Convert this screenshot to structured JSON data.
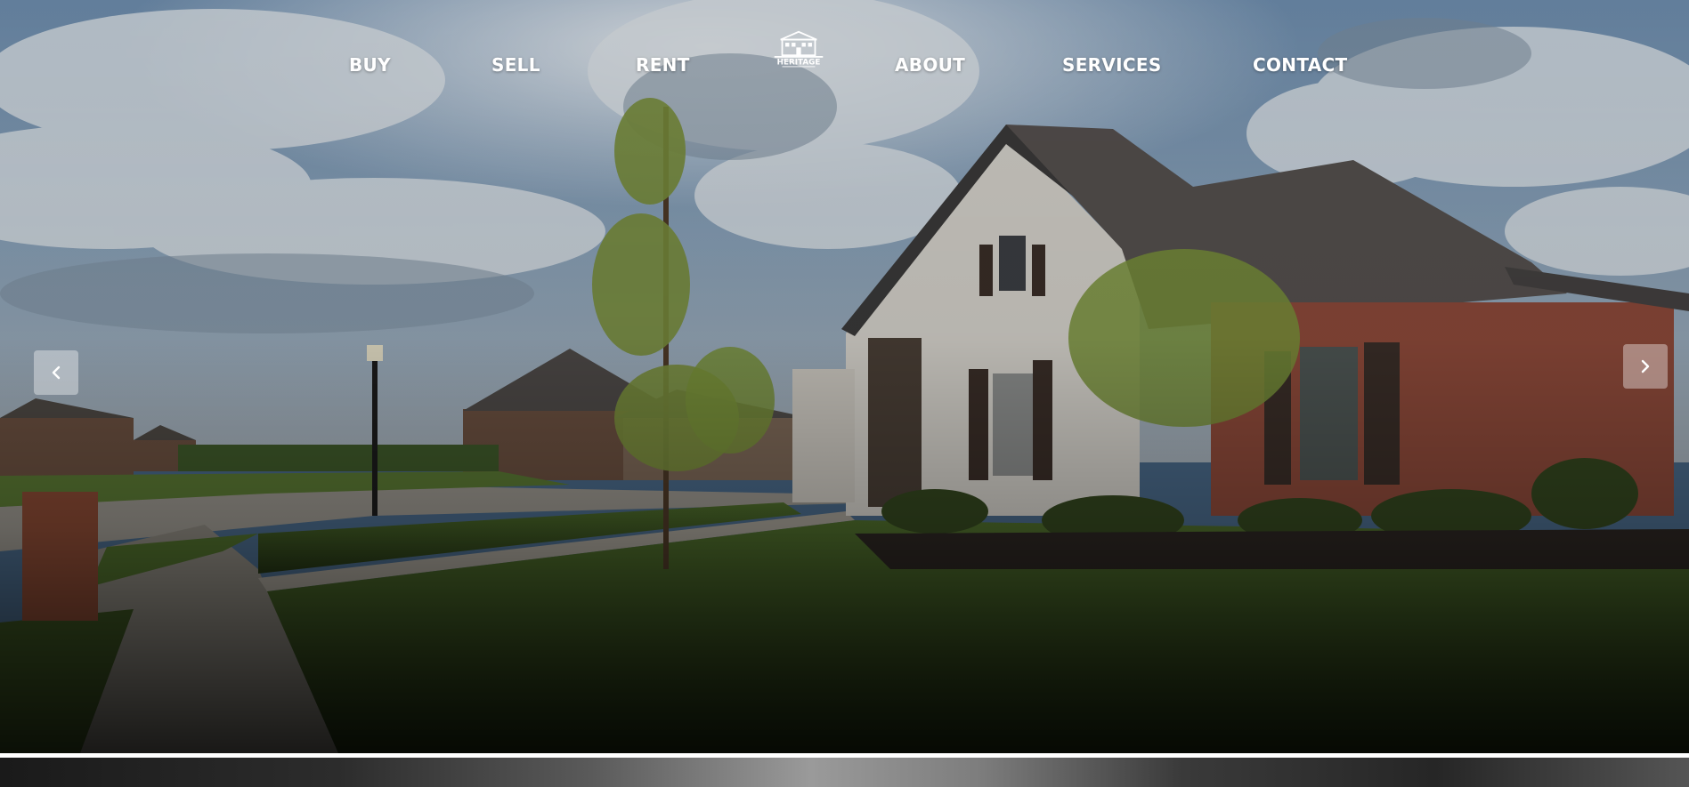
{
  "nav": {
    "items": [
      {
        "label": "BUY"
      },
      {
        "label": "SELL"
      },
      {
        "label": "RENT"
      },
      {
        "label": "ABOUT"
      },
      {
        "label": "SERVICES"
      },
      {
        "label": "CONTACT"
      }
    ],
    "logo": {
      "label": "HERITAGE"
    }
  },
  "hero": {
    "image": "suburban-house-photo",
    "prev_icon": "chevron-left-icon",
    "next_icon": "chevron-right-icon"
  },
  "colors": {
    "nav_text": "#ffffff",
    "arrow_bg": "rgba(255,255,255,0.38)",
    "divider": "#ffffff"
  }
}
